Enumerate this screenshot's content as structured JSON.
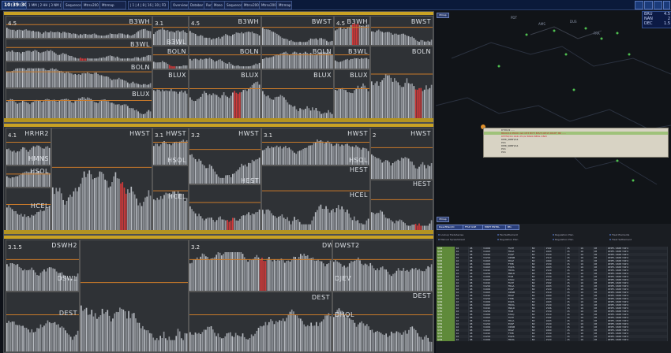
{
  "topbar": {
    "clock": "10:39:30",
    "buttons": [
      "1 MM | 2 HH | 3 NM | 4 FMS",
      "Sequence",
      "Mtrsv200",
      "Mtrmap",
      "| 1 | 4 | 8 | 16 | 30 | FD",
      "Overview",
      "Databar",
      "Run",
      "Mono",
      "Sequence",
      "Mtrsv200",
      "Mtrsv200",
      "Mtrmap"
    ]
  },
  "panels": [
    {
      "id": "top",
      "cells": [
        {
          "label": "B3WH",
          "value": "4.5"
        },
        {
          "label": "B3WL",
          "value": ""
        },
        {
          "label": "BOLN",
          "value": ""
        },
        {
          "label": "BLUX",
          "value": ""
        },
        {
          "label": "B3WL",
          "value": ""
        },
        {
          "label": "BWST",
          "value": "3.1"
        },
        {
          "label": "B3WH",
          "value": "4.5"
        },
        {
          "label": "BWST",
          "value": "3.1"
        },
        {
          "label": "B3WH",
          "value": "4.5"
        },
        {
          "label": "BWST",
          "value": "3.1"
        },
        {
          "label": "BOLN",
          "value": ""
        },
        {
          "label": "BLUX",
          "value": ""
        },
        {
          "label": "BOLN",
          "value": ""
        },
        {
          "label": "BLUX",
          "value": ""
        },
        {
          "label": "BOLN",
          "value": ""
        },
        {
          "label": "BLUX",
          "value": ""
        },
        {
          "label": "B3WL",
          "value": ""
        },
        {
          "label": "BOLN",
          "value": ""
        },
        {
          "label": "BLUX",
          "value": ""
        }
      ]
    },
    {
      "id": "middle",
      "cells": [
        {
          "label": "HRHR2",
          "value": "4.1"
        },
        {
          "label": "HMNS",
          "value": ""
        },
        {
          "label": "HSOL",
          "value": ""
        },
        {
          "label": "HCEL",
          "value": ""
        },
        {
          "label": "HWST",
          "value": ""
        },
        {
          "label": "HWST",
          "value": "3.1"
        },
        {
          "label": "HWST",
          "value": "3.2"
        },
        {
          "label": "HWST",
          "value": "3.1"
        },
        {
          "label": "HWST",
          "value": "2"
        },
        {
          "label": "HSOL",
          "value": ""
        },
        {
          "label": "HEST",
          "value": ""
        },
        {
          "label": "HCEL",
          "value": ""
        },
        {
          "label": "HEST",
          "value": ""
        },
        {
          "label": "HSOL",
          "value": ""
        },
        {
          "label": "HEST",
          "value": ""
        },
        {
          "label": "HCEL",
          "value": ""
        },
        {
          "label": "HEST",
          "value": ""
        }
      ]
    },
    {
      "id": "bottom",
      "cells": [
        {
          "label": "DSWH2",
          "value": "3.1.5"
        },
        {
          "label": "DSWL",
          "value": ""
        },
        {
          "label": "DEST",
          "value": ""
        },
        {
          "label": "DWST",
          "value": "3.2"
        },
        {
          "label": "DWST2",
          "value": ""
        },
        {
          "label": "DEST",
          "value": ""
        },
        {
          "label": "DJEV",
          "value": ""
        },
        {
          "label": "DEST",
          "value": ""
        },
        {
          "label": "DHOL",
          "value": ""
        }
      ]
    }
  ],
  "map": {
    "mini_button": "Mmap",
    "bottom_button": "Mmap",
    "stats": [
      {
        "k": "BRU",
        "v": "4.5"
      },
      {
        "k": "NAN",
        "v": "2"
      },
      {
        "k": "DEC",
        "v": "1.5"
      }
    ],
    "infobox_rows": [
      "DTXD/2 .....",
      "BK00/10  P0001 G0  CE3  BVTI  BI5/5  I0E15   DRXF/  B0 .....",
      "DFP5E/X0 0041 E1/I2 BSR0 BENL DNI3",
      "DMK_SRBH/A1",
      "PU1",
      "DMK_SRBH/A1",
      "PU1",
      "PU1"
    ]
  },
  "list": {
    "tabs": [
      "DwarfPlan/IO",
      "FTLP ILSE",
      "MSET ENTRL",
      "Bfx"
    ],
    "filters": [
      "Lookup TradeSeries",
      "Manual Spreadsheet",
      "Fan/Settlement",
      "Regulation Plan",
      "Regulation Plan",
      "Regulation Plan",
      "Fleet Elements",
      "Fleet Settlement"
    ],
    "columns": [
      "ID",
      "ST",
      "TYP",
      "DEP",
      "ARR",
      "CALL",
      "SEC",
      "ENT",
      "EXT",
      "FL",
      "RTE"
    ],
    "rows": [
      [
        "3/44",
        "16",
        "08",
        "V4009",
        "FGTP",
        "B2",
        "1502",
        "15",
        "16",
        "08",
        "DEPFL UNSE YRP 0"
      ],
      [
        "3/44",
        "16",
        "08",
        "V4003",
        "FRGA",
        "B2",
        "1603",
        "15",
        "16",
        "08",
        "DEPFL UNSE YRP 0"
      ],
      [
        "3/45",
        "16",
        "08",
        "V4010",
        "EQSF",
        "B2",
        "1520",
        "15",
        "16",
        "08",
        "DEPFL UNSE YRP 0"
      ],
      [
        "3/45",
        "16",
        "08",
        "V4204",
        "RRNM",
        "B2",
        "1510",
        "15",
        "16",
        "08",
        "DEPFL UNSE YRP 0"
      ],
      [
        "3/45",
        "16",
        "08",
        "V4003",
        "BYAZ",
        "B2",
        "1660",
        "15",
        "16",
        "08",
        "DEPFL UNSE YRP 0"
      ],
      [
        "3/45",
        "16",
        "08",
        "V4009",
        "FTPB",
        "B2",
        "1530",
        "15",
        "16",
        "08",
        "DEPFL UNSE YRP 0"
      ],
      [
        "3/46",
        "16",
        "08",
        "V4003",
        "EQZS",
        "B2",
        "1603",
        "15",
        "16",
        "08",
        "DEPFL UNSE YRP 0"
      ],
      [
        "3/46",
        "16",
        "08",
        "V4010",
        "FRMA",
        "B2",
        "1520",
        "15",
        "16",
        "08",
        "DEPFL UNSE YRP 0"
      ],
      [
        "3/46",
        "16",
        "08",
        "V4204",
        "BWLR",
        "B2",
        "1506",
        "15",
        "16",
        "08",
        "DEPFL UNSE YRP 0"
      ],
      [
        "3/47",
        "16",
        "08",
        "V4009",
        "FIGB",
        "B2",
        "1530",
        "15",
        "16",
        "08",
        "DEPFL UNSE YRP 0"
      ],
      [
        "3/47",
        "16",
        "08",
        "V4003",
        "EASQ",
        "B2",
        "1510",
        "15",
        "16",
        "08",
        "DEPFL UNSE YRP 0"
      ],
      [
        "3/47",
        "16",
        "08",
        "V4010",
        "FGTP",
        "B2",
        "1502",
        "15",
        "16",
        "08",
        "DEPFL UNSE YRP 0"
      ],
      [
        "3/48",
        "16",
        "08",
        "V4204",
        "FRGA",
        "B2",
        "1603",
        "15",
        "16",
        "08",
        "DEPFL UNSE YRP 0"
      ],
      [
        "3/48",
        "16",
        "08",
        "V4009",
        "EQSF",
        "B2",
        "1520",
        "15",
        "16",
        "08",
        "DEPFL UNSE YRP 0"
      ],
      [
        "3/48",
        "16",
        "08",
        "V4003",
        "RRNM",
        "B2",
        "1510",
        "15",
        "16",
        "08",
        "DEPFL UNSE YRP 0"
      ],
      [
        "3/49",
        "16",
        "08",
        "V4010",
        "BYAZ",
        "B2",
        "1660",
        "15",
        "16",
        "08",
        "DEPFL UNSE YRP 0"
      ],
      [
        "3/49",
        "16",
        "08",
        "V4204",
        "FTPB",
        "B2",
        "1530",
        "15",
        "16",
        "08",
        "DEPFL UNSE YRP 0"
      ],
      [
        "3/49",
        "16",
        "08",
        "V4009",
        "EQZS",
        "B2",
        "1603",
        "15",
        "16",
        "08",
        "DEPFL UNSE YRP 0"
      ],
      [
        "3/50",
        "16",
        "08",
        "V4003",
        "FRMA",
        "B2",
        "1520",
        "15",
        "16",
        "08",
        "DEPFL UNSE YRP 0"
      ],
      [
        "3/50",
        "16",
        "08",
        "V4010",
        "BWLR",
        "B2",
        "1506",
        "15",
        "16",
        "08",
        "DEPFL UNSE YRP 0"
      ],
      [
        "3/50",
        "16",
        "08",
        "V4204",
        "FIGB",
        "B2",
        "1530",
        "15",
        "16",
        "08",
        "DEPFL UNSE YRP 0"
      ],
      [
        "3/51",
        "16",
        "08",
        "V4009",
        "EASQ",
        "B2",
        "1510",
        "15",
        "16",
        "08",
        "DEPFL UNSE YRP 0"
      ],
      [
        "3/51",
        "16",
        "08",
        "V4003",
        "FGTP",
        "B2",
        "1502",
        "15",
        "16",
        "08",
        "DEPFL UNSE YRP 0"
      ],
      [
        "3/51",
        "16",
        "08",
        "V4010",
        "FRGA",
        "B2",
        "1603",
        "15",
        "16",
        "08",
        "DEPFL UNSE YRP 0"
      ],
      [
        "3/52",
        "16",
        "08",
        "V4204",
        "EQSF",
        "B2",
        "1520",
        "15",
        "16",
        "08",
        "DEPFL UNSE YRP 0"
      ],
      [
        "3/52",
        "16",
        "08",
        "V4009",
        "RRNM",
        "B2",
        "1510",
        "15",
        "16",
        "08",
        "DEPFL UNSE YRP 0"
      ],
      [
        "3/52",
        "16",
        "08",
        "V4003",
        "BYAZ",
        "B2",
        "1660",
        "15",
        "16",
        "08",
        "DEPFL UNSE YRP 0"
      ],
      [
        "3/53",
        "16",
        "08",
        "V4010",
        "FTPB",
        "B2",
        "1530",
        "15",
        "16",
        "08",
        "DEPFL UNSE YRP 0"
      ],
      [
        "3/53",
        "16",
        "08",
        "V4204",
        "EQZS",
        "B2",
        "1603",
        "15",
        "16",
        "08",
        "DEPFL UNSE YRP 0"
      ],
      [
        "3/53",
        "16",
        "08",
        "V4009",
        "FRMA",
        "B2",
        "1520",
        "15",
        "16",
        "08",
        "DEPFL UNSE YRP 0"
      ]
    ]
  },
  "colors": {
    "header_gold": "#c9a224",
    "bar_red": "#d23a3a",
    "threshold": "#c97a2a",
    "accent_blue": "#2a3e7a"
  }
}
